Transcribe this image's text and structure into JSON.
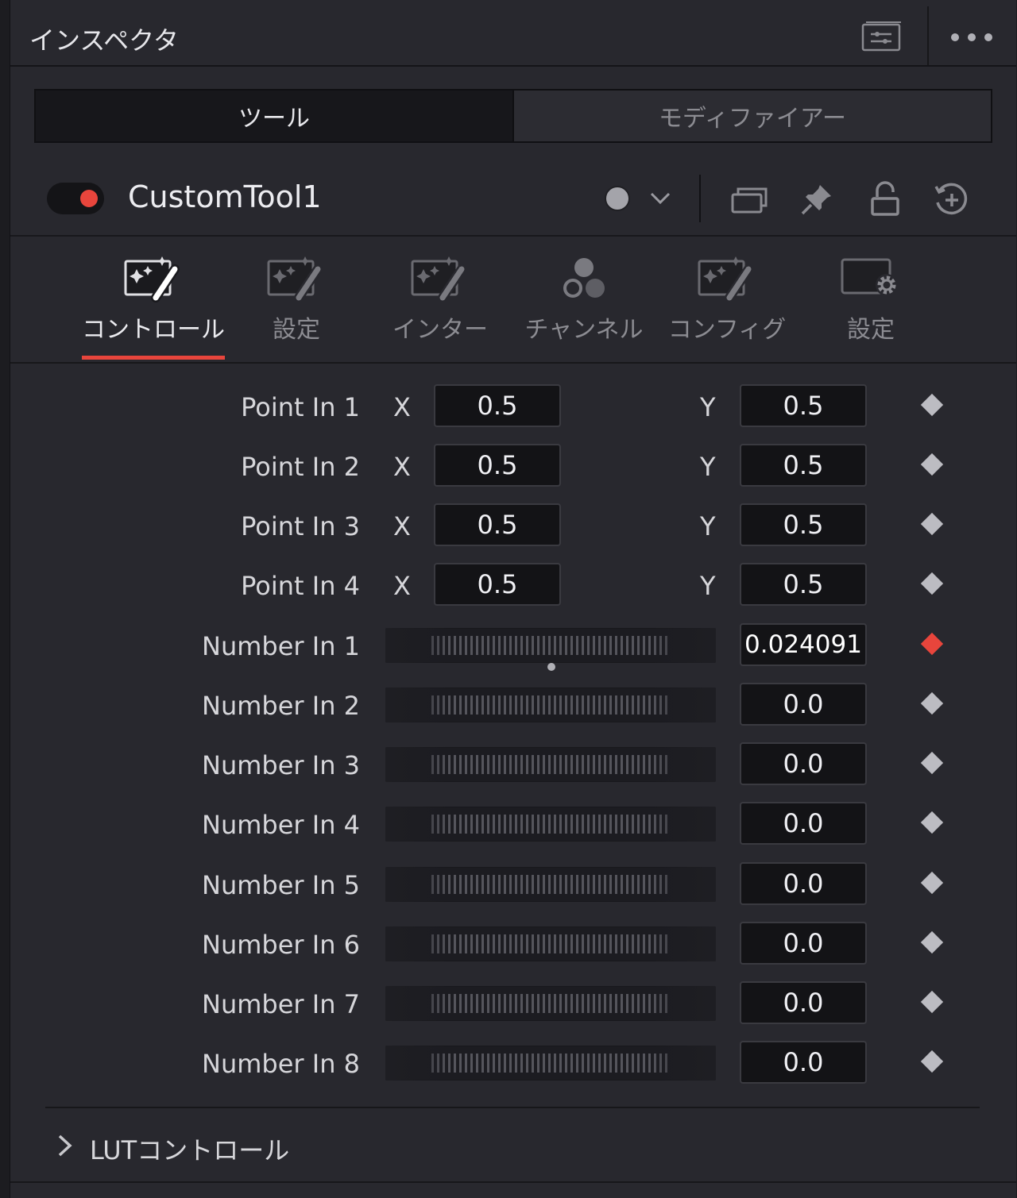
{
  "header": {
    "title": "インスペクタ"
  },
  "tabs": [
    {
      "label": "ツール",
      "active": true
    },
    {
      "label": "モディファイアー",
      "active": false
    }
  ],
  "tool": {
    "name": "CustomTool1",
    "enabled": true
  },
  "subtabs": [
    {
      "label": "コントロール",
      "active": true
    },
    {
      "label": "設定",
      "active": false
    },
    {
      "label": "インター",
      "active": false
    },
    {
      "label": "チャンネル",
      "active": false
    },
    {
      "label": "コンフィグ",
      "active": false
    },
    {
      "label": "設定",
      "active": false
    }
  ],
  "points": [
    {
      "label": "Point In 1",
      "x_axis": "X",
      "x": "0.5",
      "y_axis": "Y",
      "y": "0.5"
    },
    {
      "label": "Point In 2",
      "x_axis": "X",
      "x": "0.5",
      "y_axis": "Y",
      "y": "0.5"
    },
    {
      "label": "Point In 3",
      "x_axis": "X",
      "x": "0.5",
      "y_axis": "Y",
      "y": "0.5"
    },
    {
      "label": "Point In 4",
      "x_axis": "X",
      "x": "0.5",
      "y_axis": "Y",
      "y": "0.5"
    }
  ],
  "numbers": [
    {
      "label": "Number In 1",
      "value": "0.024091",
      "keyframed": true
    },
    {
      "label": "Number In 2",
      "value": "0.0",
      "keyframed": false
    },
    {
      "label": "Number In 3",
      "value": "0.0",
      "keyframed": false
    },
    {
      "label": "Number In 4",
      "value": "0.0",
      "keyframed": false
    },
    {
      "label": "Number In 5",
      "value": "0.0",
      "keyframed": false
    },
    {
      "label": "Number In 6",
      "value": "0.0",
      "keyframed": false
    },
    {
      "label": "Number In 7",
      "value": "0.0",
      "keyframed": false
    },
    {
      "label": "Number In 8",
      "value": "0.0",
      "keyframed": false
    }
  ],
  "lut": {
    "label": "LUTコントロール"
  },
  "colors": {
    "accent": "#e8453c",
    "background": "#28282e",
    "field": "#131316"
  }
}
